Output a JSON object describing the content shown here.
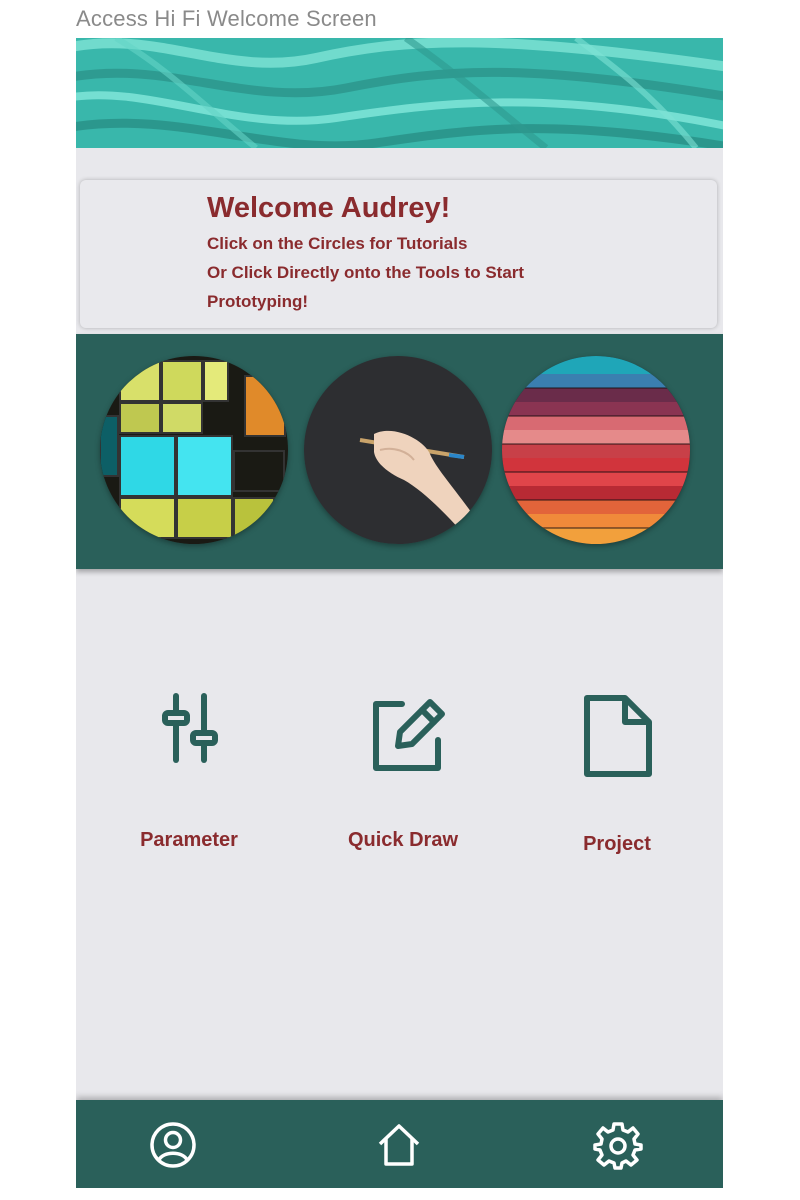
{
  "page": {
    "caption": "Access Hi Fi Welcome Screen"
  },
  "welcome": {
    "title": "Welcome Audrey!",
    "line1": "Click on the Circles for Tutorials",
    "line2": "Or Click Directly onto the Tools to Start",
    "line3": "Prototyping!"
  },
  "tutorials": [
    {
      "icon": "sticky-notes-grid-image"
    },
    {
      "icon": "hand-drawing-pencil-image"
    },
    {
      "icon": "stacked-colorful-folders-image"
    }
  ],
  "tools": [
    {
      "label": "Parameter",
      "icon": "sliders-icon"
    },
    {
      "label": "Quick Draw",
      "icon": "edit-pencil-icon"
    },
    {
      "label": "Project",
      "icon": "document-icon"
    }
  ],
  "nav": [
    {
      "icon": "user-profile-icon"
    },
    {
      "icon": "home-icon"
    },
    {
      "icon": "settings-gear-icon"
    }
  ],
  "colors": {
    "accent": "#2a605a",
    "text_accent": "#8a2b2e",
    "background": "#e8e8ec",
    "hero": "#3ec1b5"
  }
}
